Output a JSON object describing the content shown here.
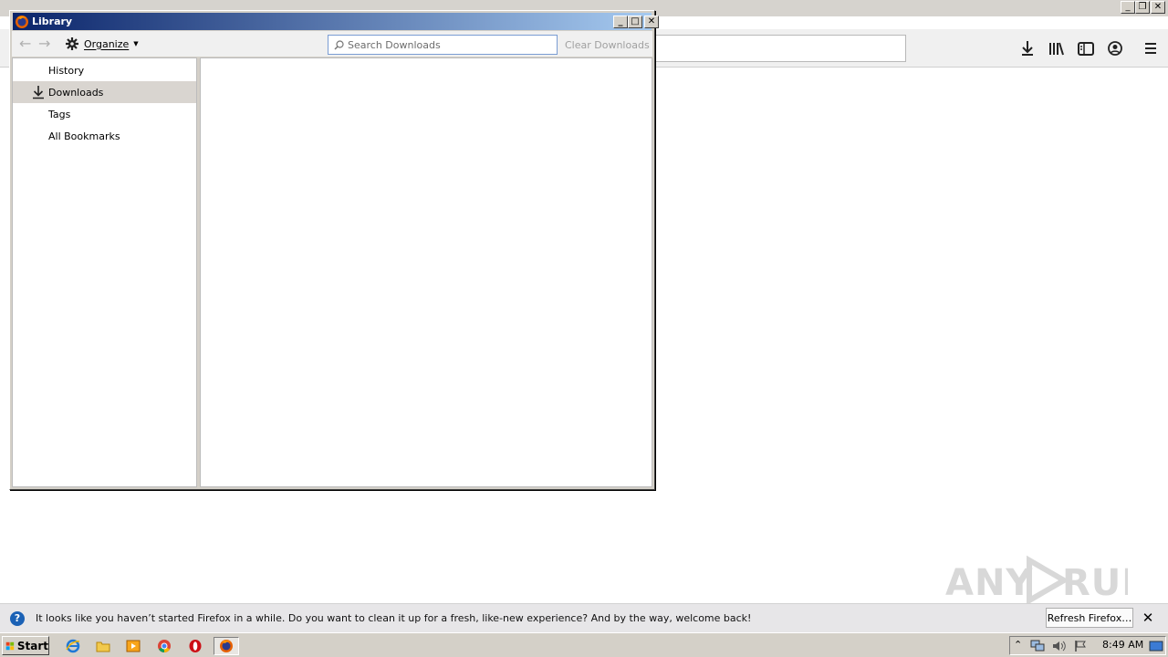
{
  "browser": {
    "window_controls": {
      "minimize": "_",
      "restore": "❐",
      "close": "✕"
    }
  },
  "library": {
    "title": "Library",
    "toolbar": {
      "back": "←",
      "forward": "→",
      "organize_label": "Organize",
      "search_placeholder": "Search Downloads",
      "clear_label": "Clear Downloads"
    },
    "window_controls": {
      "minimize": "_",
      "maximize": "□",
      "close": "✕"
    },
    "sidebar": {
      "items": [
        {
          "label": "History",
          "icon": "none",
          "selected": false
        },
        {
          "label": "Downloads",
          "icon": "download-icon",
          "selected": true
        },
        {
          "label": "Tags",
          "icon": "none",
          "selected": false
        },
        {
          "label": "All Bookmarks",
          "icon": "none",
          "selected": false
        }
      ]
    }
  },
  "notification": {
    "text": "It looks like you haven’t started Firefox in a while. Do you want to clean it up for a fresh, like-new experience? And by the way, welcome back!",
    "refresh_label": "Refresh Firefox…",
    "close": "✕"
  },
  "watermark": {
    "text": "ANY RUN"
  },
  "taskbar": {
    "start_label": "Start",
    "quick_launch": [
      "ie-icon",
      "explorer-icon",
      "media-player-icon",
      "chrome-icon",
      "opera-icon",
      "firefox-icon"
    ],
    "clock": "8:49 AM"
  },
  "colors": {
    "title_gradient_start": "#0a246a",
    "title_gradient_end": "#a6caf0",
    "selected_row": "#d9d5d0",
    "notification_bg": "#e7e6e8",
    "taskbar_bg": "#d4d0c8"
  }
}
